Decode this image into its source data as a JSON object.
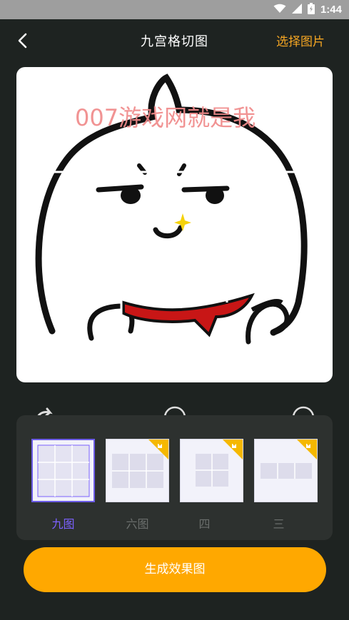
{
  "status_bar": {
    "time": "1:44"
  },
  "header": {
    "title": "九宫格切图",
    "select_image_label": "选择图片"
  },
  "preview": {
    "watermark_text": "007游戏网就是我"
  },
  "layouts": [
    {
      "label": "九图",
      "selected": true,
      "vip": false
    },
    {
      "label": "六图",
      "selected": false,
      "vip": true
    },
    {
      "label": "四",
      "selected": false,
      "vip": true
    },
    {
      "label": "三",
      "selected": false,
      "vip": true
    }
  ],
  "generate_button_label": "生成效果图",
  "colors": {
    "accent": "#f5a623",
    "button": "#ffa800",
    "selected": "#7b61ff",
    "background": "#1e2321",
    "panel": "#2d312f"
  }
}
